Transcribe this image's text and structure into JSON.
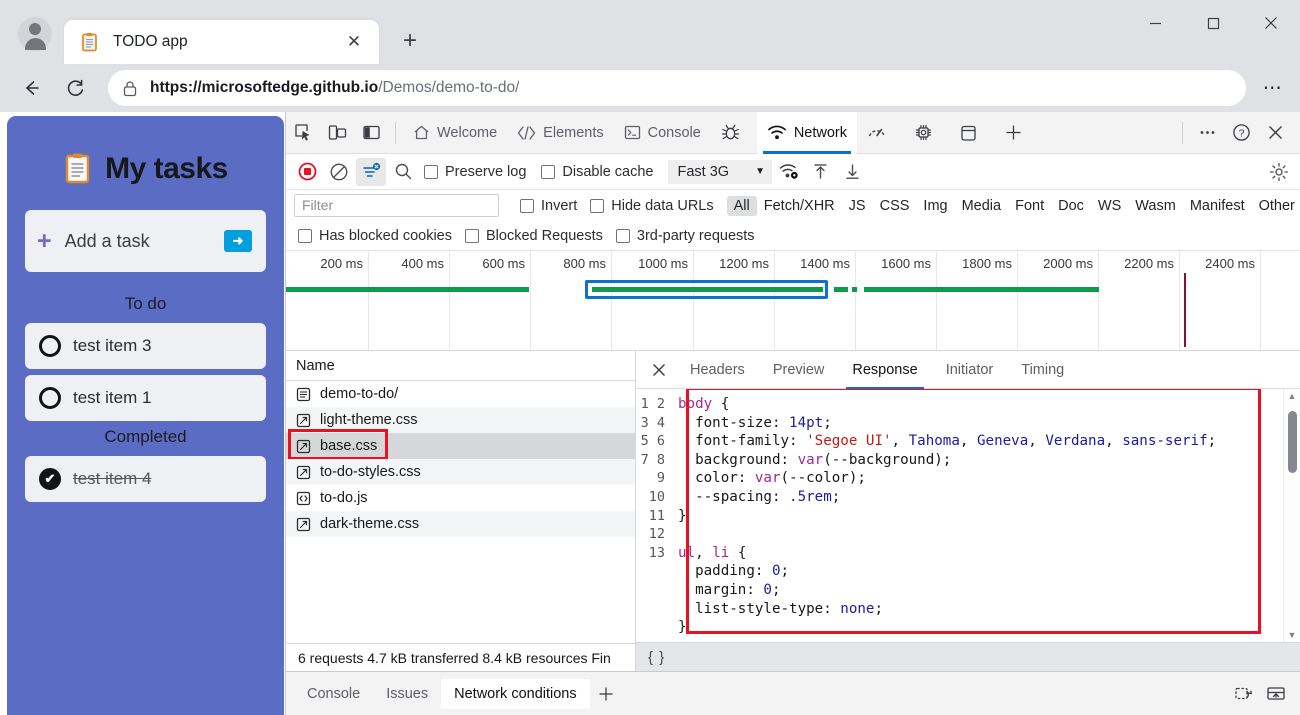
{
  "browser": {
    "tab": {
      "title": "TODO app",
      "favicon": "clipboard-icon",
      "close": "✕"
    },
    "new_tab": "+",
    "window_controls": {
      "minimize": "—",
      "maximize": "□",
      "close": "✕"
    },
    "nav": {
      "back": "←",
      "reload": "⟳",
      "more": "⋯"
    },
    "address": {
      "lock": "lock-icon",
      "url_bold": "https://microsoftedge.github.io",
      "url_rest": "/Demos/demo-to-do/"
    }
  },
  "todo_app": {
    "title": "My tasks",
    "add_task": {
      "plus": "+",
      "label": "Add a task",
      "submit": "➜"
    },
    "sections": [
      {
        "label": "To do",
        "items": [
          {
            "text": "test item 3",
            "done": false
          },
          {
            "text": "test item 1",
            "done": false
          }
        ]
      },
      {
        "label": "Completed",
        "items": [
          {
            "text": "test item 4",
            "done": true,
            "check": "✔"
          }
        ]
      }
    ]
  },
  "devtools": {
    "left_icons": [
      "inspect-icon",
      "device-toolbar-icon",
      "dock-side-icon"
    ],
    "panels": [
      {
        "label": "Welcome",
        "icon": "home-icon",
        "active": false
      },
      {
        "label": "Elements",
        "icon": "code-brackets-icon",
        "active": false
      },
      {
        "label": "Console",
        "icon": "terminal-icon",
        "active": false
      },
      {
        "label": "",
        "icon": "bug-icon",
        "active": false
      },
      {
        "label": "Network",
        "icon": "wifi-icon",
        "active": true
      },
      {
        "label": "",
        "icon": "performance-icon",
        "active": false
      },
      {
        "label": "",
        "icon": "settings-gear-icon",
        "active": false
      },
      {
        "label": "",
        "icon": "application-icon",
        "active": false
      },
      {
        "label": "",
        "icon": "plus-icon",
        "active": false
      }
    ],
    "right_icons": [
      "more-options-icon",
      "help-icon",
      "close-icon"
    ],
    "network_toolbar": {
      "record": "record-icon",
      "clear": "clear-icon",
      "filter": "filter-icon",
      "search": "search-icon",
      "preserve_log": {
        "label": "Preserve log",
        "checked": false
      },
      "disable_cache": {
        "label": "Disable cache",
        "checked": false
      },
      "throttle": "Fast 3G",
      "throttle_caret": "▼",
      "network_conditions": "network-conditions-icon",
      "import_har": "import-har-icon",
      "export_har": "export-har-icon",
      "settings": "settings-gear-icon"
    },
    "filter_bar": {
      "placeholder": "Filter",
      "invert": {
        "label": "Invert",
        "checked": false
      },
      "hide_data_urls": {
        "label": "Hide data URLs",
        "checked": false
      },
      "types": [
        "All",
        "Fetch/XHR",
        "JS",
        "CSS",
        "Img",
        "Media",
        "Font",
        "Doc",
        "WS",
        "Wasm",
        "Manifest",
        "Other"
      ],
      "active_type": "All",
      "has_blocked_cookies": {
        "label": "Has blocked cookies",
        "checked": false
      },
      "blocked_requests": {
        "label": "Blocked Requests",
        "checked": false
      },
      "third_party": {
        "label": "3rd-party requests",
        "checked": false
      }
    },
    "overview": {
      "ticks": [
        "200 ms",
        "400 ms",
        "600 ms",
        "800 ms",
        "1000 ms",
        "1200 ms",
        "1400 ms",
        "1600 ms",
        "1800 ms",
        "2000 ms",
        "2200 ms",
        "2400 ms"
      ]
    },
    "requests": {
      "column_header": "Name",
      "rows": [
        {
          "name": "demo-to-do/",
          "icon": "document-icon",
          "selected": false
        },
        {
          "name": "light-theme.css",
          "icon": "stylesheet-icon",
          "selected": false
        },
        {
          "name": "base.css",
          "icon": "stylesheet-icon",
          "selected": true,
          "highlighted": true
        },
        {
          "name": "to-do-styles.css",
          "icon": "stylesheet-icon",
          "selected": false
        },
        {
          "name": "to-do.js",
          "icon": "script-icon",
          "selected": false
        },
        {
          "name": "dark-theme.css",
          "icon": "stylesheet-icon",
          "selected": false
        }
      ],
      "status": "6 requests  4.7 kB transferred  8.4 kB resources  Fin"
    },
    "detail": {
      "close": "✕",
      "tabs": [
        "Headers",
        "Preview",
        "Response",
        "Initiator",
        "Timing"
      ],
      "active_tab": "Response",
      "highlight_color": "#e81123",
      "format_button": "{ }",
      "line_numbers": [
        1,
        2,
        3,
        4,
        5,
        6,
        7,
        8,
        9,
        10,
        11,
        12,
        13
      ],
      "code_lines": [
        [
          [
            "c-sel",
            "body"
          ],
          [
            "c-punct",
            " {"
          ]
        ],
        [
          [
            "c-prop",
            "  font-size: "
          ],
          [
            "c-num",
            "14pt"
          ],
          [
            "c-punct",
            ";"
          ]
        ],
        [
          [
            "c-prop",
            "  font-family: "
          ],
          [
            "c-str",
            "'Segoe UI'"
          ],
          [
            "c-punct",
            ", "
          ],
          [
            "c-val",
            "Tahoma"
          ],
          [
            "c-punct",
            ", "
          ],
          [
            "c-val",
            "Geneva"
          ],
          [
            "c-punct",
            ", "
          ],
          [
            "c-val",
            "Verdana"
          ],
          [
            "c-punct",
            ", "
          ],
          [
            "c-val",
            "sans-serif"
          ],
          [
            "c-punct",
            ";"
          ]
        ],
        [
          [
            "c-prop",
            "  background: "
          ],
          [
            "c-fn",
            "var"
          ],
          [
            "c-punct",
            "(--background);"
          ]
        ],
        [
          [
            "c-prop",
            "  color: "
          ],
          [
            "c-fn",
            "var"
          ],
          [
            "c-punct",
            "(--color);"
          ]
        ],
        [
          [
            "c-prop",
            "  --spacing: "
          ],
          [
            "c-num",
            ".5rem"
          ],
          [
            "c-punct",
            ";"
          ]
        ],
        [
          [
            "c-punct",
            "}"
          ]
        ],
        [
          [
            "c-punct",
            ""
          ]
        ],
        [
          [
            "c-sel",
            "ul"
          ],
          [
            "c-punct",
            ", "
          ],
          [
            "c-sel",
            "li"
          ],
          [
            "c-punct",
            " {"
          ]
        ],
        [
          [
            "c-prop",
            "  padding: "
          ],
          [
            "c-num",
            "0"
          ],
          [
            "c-punct",
            ";"
          ]
        ],
        [
          [
            "c-prop",
            "  margin: "
          ],
          [
            "c-num",
            "0"
          ],
          [
            "c-punct",
            ";"
          ]
        ],
        [
          [
            "c-prop",
            "  list-style-type: "
          ],
          [
            "c-val",
            "none"
          ],
          [
            "c-punct",
            ";"
          ]
        ],
        [
          [
            "c-punct",
            "}"
          ]
        ]
      ],
      "scroll_up": "▲",
      "scroll_down": "▼"
    },
    "drawer": {
      "tabs": [
        "Console",
        "Issues",
        "Network conditions"
      ],
      "active_tab": "Network conditions",
      "add": "+",
      "icons": [
        "restore-drawer-icon",
        "dock-drawer-icon"
      ]
    }
  },
  "colors": {
    "accent_blue": "#0a72d4",
    "sidebar_purple": "#5b6cc4",
    "highlight_red": "#e81123",
    "waterfall_green": "#0e9b4c"
  }
}
